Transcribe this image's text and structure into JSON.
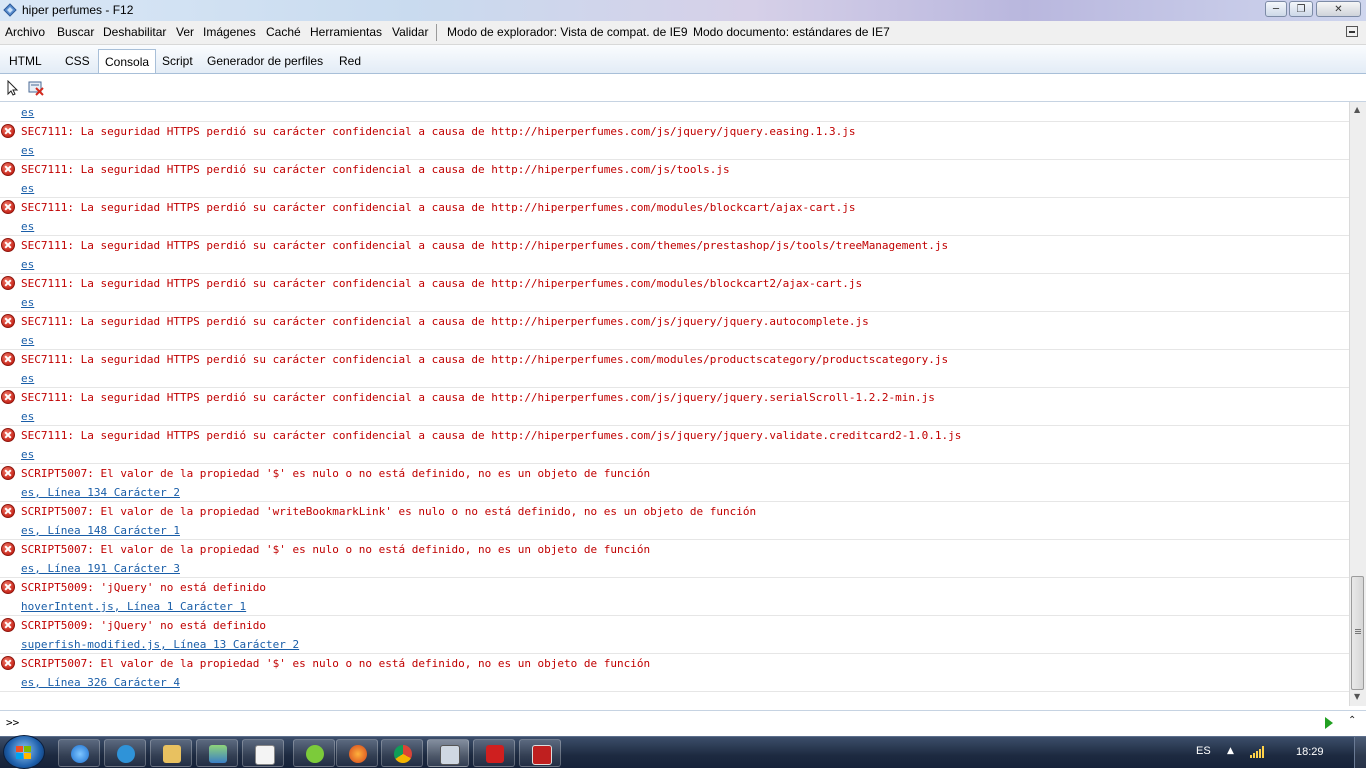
{
  "window": {
    "title": "hiper perfumes - F12"
  },
  "menu": [
    {
      "label": "Archivo"
    },
    {
      "label": "Buscar"
    },
    {
      "label": "Deshabilitar"
    },
    {
      "label": "Ver"
    },
    {
      "label": "Imágenes"
    },
    {
      "label": "Caché"
    },
    {
      "label": "Herramientas"
    },
    {
      "label": "Validar"
    },
    {
      "label": "Modo de explorador: Vista de compat. de IE9"
    },
    {
      "label": "Modo documento:  estándares de IE7"
    }
  ],
  "tabs": [
    {
      "label": "HTML"
    },
    {
      "label": "CSS"
    },
    {
      "label": "Consola",
      "active": true
    },
    {
      "label": "Script"
    },
    {
      "label": "Generador de perfiles"
    },
    {
      "label": "Red"
    }
  ],
  "console": {
    "first_partial_source": "es",
    "entries": [
      {
        "message": "SEC7111: La seguridad HTTPS perdió su carácter confidencial a causa de http://hiperperfumes.com/js/jquery/jquery.easing.1.3.js",
        "source": "es"
      },
      {
        "message": "SEC7111: La seguridad HTTPS perdió su carácter confidencial a causa de http://hiperperfumes.com/js/tools.js",
        "source": "es"
      },
      {
        "message": "SEC7111: La seguridad HTTPS perdió su carácter confidencial a causa de http://hiperperfumes.com/modules/blockcart/ajax-cart.js",
        "source": "es"
      },
      {
        "message": "SEC7111: La seguridad HTTPS perdió su carácter confidencial a causa de http://hiperperfumes.com/themes/prestashop/js/tools/treeManagement.js",
        "source": "es"
      },
      {
        "message": "SEC7111: La seguridad HTTPS perdió su carácter confidencial a causa de http://hiperperfumes.com/modules/blockcart2/ajax-cart.js",
        "source": "es"
      },
      {
        "message": "SEC7111: La seguridad HTTPS perdió su carácter confidencial a causa de http://hiperperfumes.com/js/jquery/jquery.autocomplete.js",
        "source": "es"
      },
      {
        "message": "SEC7111: La seguridad HTTPS perdió su carácter confidencial a causa de http://hiperperfumes.com/modules/productscategory/productscategory.js",
        "source": "es"
      },
      {
        "message": "SEC7111: La seguridad HTTPS perdió su carácter confidencial a causa de http://hiperperfumes.com/js/jquery/jquery.serialScroll-1.2.2-min.js",
        "source": "es"
      },
      {
        "message": "SEC7111: La seguridad HTTPS perdió su carácter confidencial a causa de http://hiperperfumes.com/js/jquery/jquery.validate.creditcard2-1.0.1.js",
        "source": "es"
      },
      {
        "message": "SCRIPT5007: El valor de la propiedad '$' es nulo o no está definido, no es un objeto de función",
        "source": "es, Línea 134 Carácter 2"
      },
      {
        "message": "SCRIPT5007: El valor de la propiedad 'writeBookmarkLink' es nulo o no está definido, no es un objeto de función",
        "source": "es, Línea 148 Carácter 1"
      },
      {
        "message": "SCRIPT5007: El valor de la propiedad '$' es nulo o no está definido, no es un objeto de función",
        "source": "es, Línea 191 Carácter 3"
      },
      {
        "message": "SCRIPT5009: 'jQuery' no está definido",
        "source": "hoverIntent.js, Línea 1 Carácter 1"
      },
      {
        "message": "SCRIPT5009: 'jQuery' no está definido",
        "source": "superfish-modified.js, Línea 13 Carácter 2"
      },
      {
        "message": "SCRIPT5007: El valor de la propiedad '$' es nulo o no está definido, no es un objeto de función",
        "source": "es, Línea 326 Carácter 4"
      }
    ]
  },
  "input": {
    "prompt": ">>",
    "value": ""
  },
  "taskbar": {
    "apps": [
      "ie-icon",
      "skype-icon",
      "folder-icon",
      "network-icon",
      "notepad-icon",
      "movistar-icon",
      "firefox-icon",
      "chrome-icon",
      "camera-icon",
      "acrobat-icon",
      "filezilla-icon"
    ],
    "language": "ES",
    "clock": "18:29"
  },
  "colors": {
    "error_text": "#c00000",
    "link": "#1a5ea8",
    "accent": "#a8bfd8"
  }
}
